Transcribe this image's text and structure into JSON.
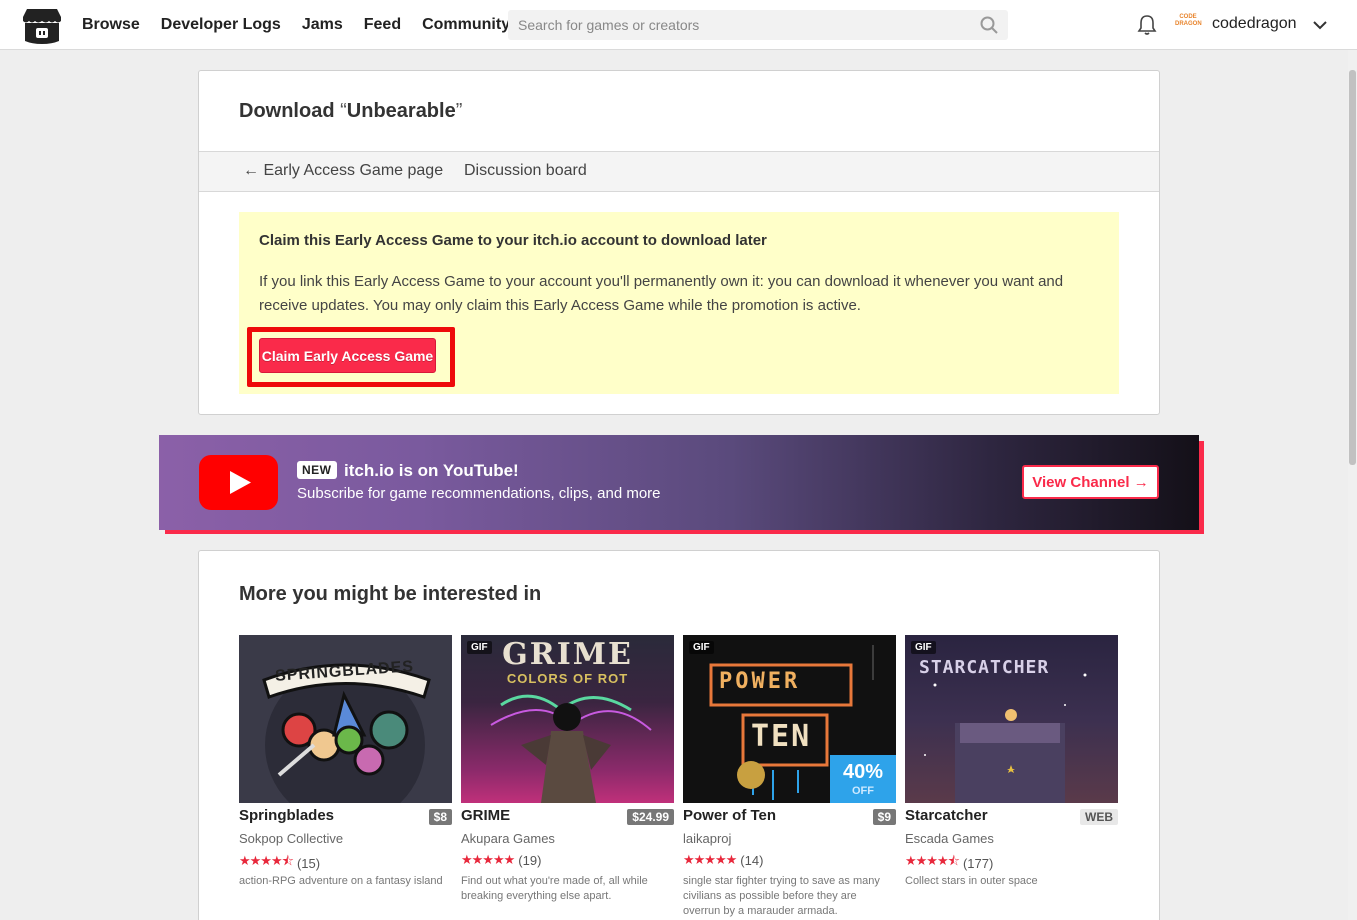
{
  "header": {
    "nav": [
      "Browse",
      "Developer Logs",
      "Jams",
      "Feed",
      "Community"
    ],
    "search_placeholder": "Search for games or creators",
    "avatar_text": "CODE DRAGON",
    "username": "codedragon"
  },
  "download": {
    "title_prefix": "Download ",
    "title_open": "“",
    "title_name": "Unbearable",
    "title_close": "”",
    "nav_back": "← Early Access Game page",
    "nav_discussion": "Discussion board",
    "claim_title": "Claim this Early Access Game to your itch.io account to download later",
    "claim_text": "If you link this Early Access Game to your account you'll permanently own it: you can download it whenever you want and receive updates. You may only claim this Early Access Game while the promotion is active.",
    "claim_button": "Claim Early Access Game"
  },
  "youtube": {
    "badge": "NEW",
    "heading": "itch.io is on YouTube!",
    "subtitle": "Subscribe for game recommendations, clips, and more",
    "button": "View Channel →"
  },
  "recommendations": {
    "title": "More you might be interested in",
    "items": [
      {
        "title": "Springblades",
        "price": "$8",
        "author": "Sokpop Collective",
        "stars": "★★★★⯪",
        "count": "(15)",
        "desc": "action-RPG adventure on a fantasy island",
        "thumb_text": "SPRINGBLADES"
      },
      {
        "title": "GRIME",
        "price": "$24.99",
        "author": "Akupara Games",
        "stars": "★★★★★",
        "count": "(19)",
        "desc": "Find out what you're made of, all while breaking everything else apart.",
        "gif": "GIF",
        "thumb_text": "GRIME",
        "thumb_sub": "COLORS OF ROT"
      },
      {
        "title": "Power of Ten",
        "price": "$9",
        "author": "laikaproj",
        "stars": "★★★★★",
        "count": "(14)",
        "desc": "single star fighter trying to save as many civilians as possible before they are overrun by a marauder armada.",
        "gif": "GIF",
        "thumb_text": "POWER",
        "thumb_sub": "TEN",
        "sale_pct": "40%",
        "sale_off": "OFF"
      },
      {
        "title": "Starcatcher",
        "price": "WEB",
        "author": "Escada Games",
        "stars": "★★★★⯪",
        "count": "(177)",
        "desc": "Collect stars in outer space",
        "gif": "GIF",
        "thumb_text": "STARCATCHER"
      }
    ]
  },
  "colors": {
    "accent": "#fa2a4a",
    "highlight_box": "#ffffc9",
    "sale": "#2ea3ea"
  }
}
